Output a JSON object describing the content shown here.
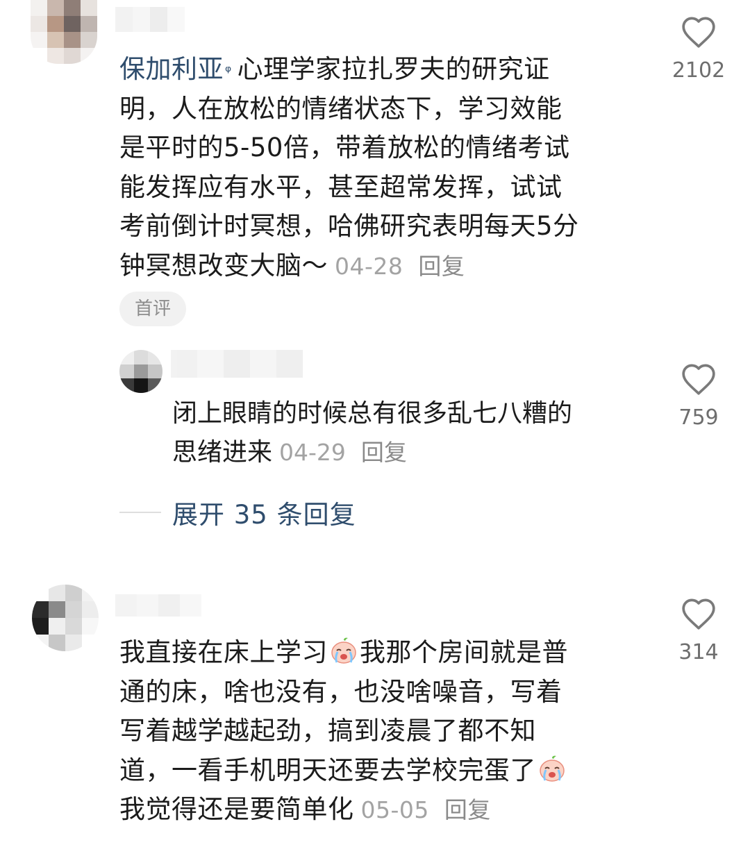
{
  "comments": [
    {
      "username": "保加利亚",
      "ip_icon": "location-pin-icon",
      "text_lines": [
        "心理学家拉扎罗夫的研究证",
        "明，人在放松的情绪状态下，学习效能",
        "是平时的5-50倍，带着放松的情绪考试",
        "能发挥应有水平，甚至超常发挥，试试",
        "考前倒计时冥想，哈佛研究表明每天5分",
        "钟冥想改变大脑～"
      ],
      "date": "04-28",
      "reply_label": "回复",
      "badge": "首评",
      "likes": "2102",
      "replies": [
        {
          "text_lines": [
            "闭上眼睛的时候总有很多乱七八糟的",
            "思绪进来"
          ],
          "date": "04-29",
          "reply_label": "回复",
          "likes": "759"
        }
      ],
      "expand_label": "展开 35 条回复"
    },
    {
      "text_lines": [
        "我直接在床上学习",
        "我那个房间就是普",
        "通的床，啥也没有，也没啥噪音，写着",
        "写着越学越起劲，搞到凌晨了都不知",
        "道，一看手机明天还要去学校完蛋了",
        "我觉得还是要简单化"
      ],
      "emoji": "crying-face-emoji",
      "date": "05-05",
      "reply_label": "回复",
      "likes": "314"
    }
  ],
  "icons": {
    "like": "heart-outline-icon"
  },
  "colors": {
    "username": "#2f4d6d",
    "meta": "#a3a3a3",
    "text": "#1b1b1b"
  }
}
